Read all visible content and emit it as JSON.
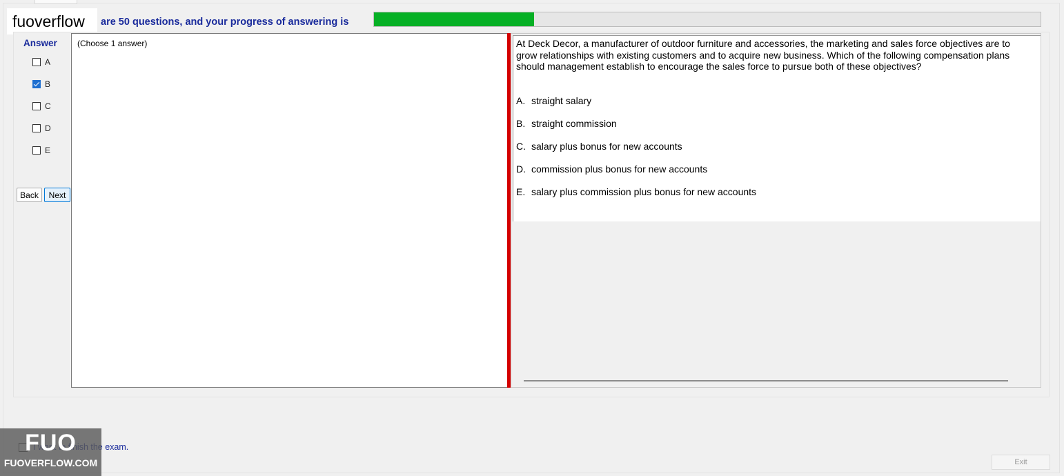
{
  "header": {
    "logo_text": "fuoverflow",
    "progress_text": "are 50 questions, and your progress of answering is",
    "progress_fraction": 0.24,
    "progress_color": "#06b025"
  },
  "answer_panel": {
    "title": "Answer",
    "options": [
      {
        "label": "A",
        "checked": false
      },
      {
        "label": "B",
        "checked": true
      },
      {
        "label": "C",
        "checked": false
      },
      {
        "label": "D",
        "checked": false
      },
      {
        "label": "E",
        "checked": false
      }
    ],
    "back_label": "Back",
    "next_label": "Next"
  },
  "left_pane": {
    "instruction": "(Choose 1 answer)"
  },
  "question": {
    "text": "At Deck Decor, a manufacturer of outdoor furniture and accessories, the marketing and sales force objectives are to grow relationships with existing customers and to acquire new business. Which of the following compensation plans should management establish to encourage the sales force to pursue both of these objectives?",
    "choices": [
      {
        "letter": "A.",
        "text": "straight salary"
      },
      {
        "letter": "B.",
        "text": "straight commission"
      },
      {
        "letter": "C.",
        "text": "salary plus bonus for new accounts"
      },
      {
        "letter": "D.",
        "text": "commission plus bonus for new accounts"
      },
      {
        "letter": "E.",
        "text": "salary plus commission plus bonus for new accounts"
      }
    ]
  },
  "footer": {
    "finish_text": "I want to finish the exam.",
    "exit_label": "Exit",
    "watermark_big": "FUO",
    "watermark_small": "FUOVERFLOW.COM"
  },
  "colors": {
    "accent_text": "#1a2b9c",
    "splitter": "#d40000",
    "checkbox_checked": "#1e6fd0"
  }
}
